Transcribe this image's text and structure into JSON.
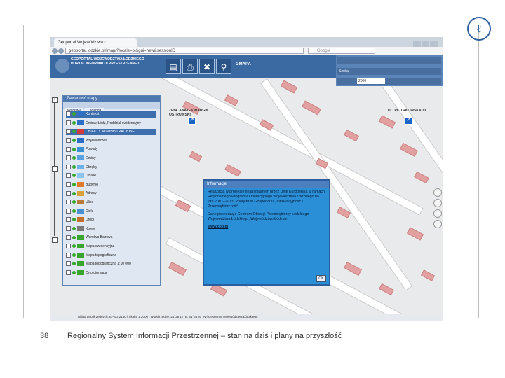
{
  "slide": {
    "page_number": "38",
    "footer_text": "Regionalny System Informacji Przestrzennej – stan na dziś i plany na przyszłość"
  },
  "browser": {
    "tab_title": "Geoportal Województwa Ł...",
    "url": "geoportal.lodzkie.pl/imap/?locale=pl&gui=new&sessionID",
    "search_placeholder": "Google"
  },
  "app": {
    "header_title": "GEOPORTAL WOJEWÓDZTWA ŁÓDZKIEGO",
    "header_subtitle": "PORTAL INFORMACJI PRZESTRZENNEJ",
    "tool_label": "GMAPA"
  },
  "right_panel": {
    "search_label": "Szukaj",
    "scale_value": "2000"
  },
  "layers_panel": {
    "title": "Zawartość mapy",
    "tabs": [
      "Warstwy",
      "Legenda"
    ],
    "items": [
      {
        "label": "Kontekst",
        "highlight": true
      },
      {
        "label": "Gmina: Łódź, Poddział ewidencyjny"
      },
      {
        "label": "OBIEKTY ADMINISTRACYJNE",
        "highlight": true
      },
      {
        "label": "Województwa"
      },
      {
        "label": "Powiaty"
      },
      {
        "label": "Gminy"
      },
      {
        "label": "Obręby"
      },
      {
        "label": "Działki"
      },
      {
        "label": "Budynki"
      },
      {
        "label": "Adresy"
      },
      {
        "label": "Ulice"
      },
      {
        "label": "Cieki"
      },
      {
        "label": "Drogi"
      },
      {
        "label": "Koleje"
      },
      {
        "label": "Warstwa Bazowa"
      },
      {
        "label": "Mapa ewidencyjna"
      },
      {
        "label": "Mapa topograficzna"
      },
      {
        "label": "Mapa topograficzna 1:10 000"
      },
      {
        "label": "Ortofotomapa"
      }
    ]
  },
  "map_labels": {
    "label_1": "ZPBŁ ANATEK MARGIN OSTROWSKI",
    "label_2": "UL. PIOTRKOWSKA 33"
  },
  "info_popup": {
    "title": "Informacje",
    "paragraph_1": "Realizacja w projekcie finansowanym przez Unię Europejską w ramach Regionalnego Programu Operacyjnego Województwa Łódzkiego na lata 2007–2013, Priorytet III Gospodarka, Innowacyjność i Przedsiębiorczość.",
    "paragraph_2": "Dane pochodzą z Centrum Obsługi Przedsiębiorcy Łódzkiego Województwa Łódzkiego, Województwo Łódzkie.",
    "link": "www.cop.pl",
    "ok_label": "OK"
  },
  "status": {
    "text": "Układ współrzędnych: EPSG:2180 | Skala: 1:2000 | Współrzędne: 21°25'12\" E, 51°45'30\" N | Geoportal Województwa Łódzkiego"
  },
  "colors": {
    "header_blue": "#3b6aa3",
    "building": "#e2a0a0",
    "popup_blue": "#2b8fd8"
  }
}
